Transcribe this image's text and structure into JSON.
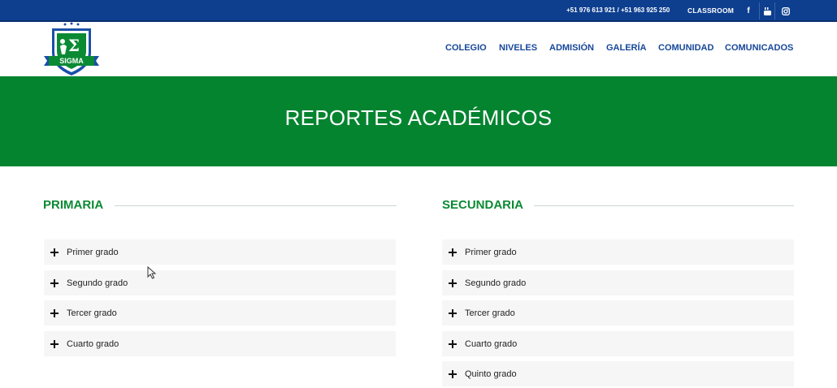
{
  "topbar": {
    "phones": "+51 976 613 921 / +51 963 925 250",
    "classroom": "CLASSROOM",
    "social": [
      {
        "icon": "facebook-icon",
        "glyph": "f"
      },
      {
        "icon": "youtube-icon",
        "glyph": "▶"
      },
      {
        "icon": "instagram-icon",
        "glyph": "◎"
      }
    ],
    "bg_color": "#0e3f8f"
  },
  "logo": {
    "text": "SIGMA",
    "symbol": "Σ",
    "colors": {
      "blue": "#1a4fa8",
      "green": "#0b8a34"
    }
  },
  "nav": {
    "items": [
      "COLEGIO",
      "NIVELES",
      "ADMISIÓN",
      "GALERÍA",
      "COMUNIDAD",
      "COMUNICADOS"
    ],
    "color": "#17479a"
  },
  "banner": {
    "title": "REPORTES ACADÉMICOS",
    "bg_color": "#058430"
  },
  "primaria": {
    "title": "PRIMARIA",
    "items": [
      "Primer grado",
      "Segundo grado",
      "Tercer grado",
      "Cuarto grado"
    ]
  },
  "secundaria": {
    "title": "SECUNDARIA",
    "items": [
      "Primer grado",
      "Segundo grado",
      "Tercer grado",
      "Cuarto grado",
      "Quinto grado"
    ]
  }
}
